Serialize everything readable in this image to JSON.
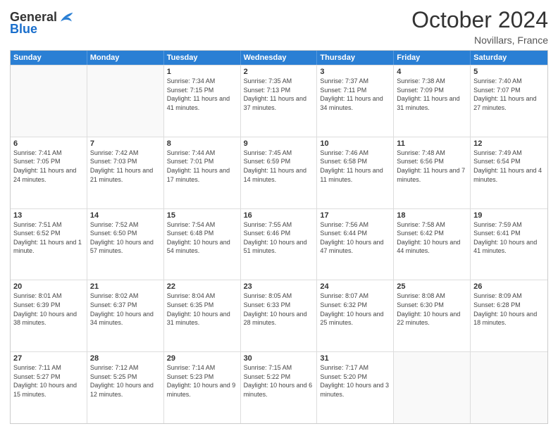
{
  "header": {
    "logo_general": "General",
    "logo_blue": "Blue",
    "month_title": "October 2024",
    "location": "Novillars, France"
  },
  "weekdays": [
    "Sunday",
    "Monday",
    "Tuesday",
    "Wednesday",
    "Thursday",
    "Friday",
    "Saturday"
  ],
  "weeks": [
    [
      {
        "day": "",
        "info": ""
      },
      {
        "day": "",
        "info": ""
      },
      {
        "day": "1",
        "info": "Sunrise: 7:34 AM\nSunset: 7:15 PM\nDaylight: 11 hours and 41 minutes."
      },
      {
        "day": "2",
        "info": "Sunrise: 7:35 AM\nSunset: 7:13 PM\nDaylight: 11 hours and 37 minutes."
      },
      {
        "day": "3",
        "info": "Sunrise: 7:37 AM\nSunset: 7:11 PM\nDaylight: 11 hours and 34 minutes."
      },
      {
        "day": "4",
        "info": "Sunrise: 7:38 AM\nSunset: 7:09 PM\nDaylight: 11 hours and 31 minutes."
      },
      {
        "day": "5",
        "info": "Sunrise: 7:40 AM\nSunset: 7:07 PM\nDaylight: 11 hours and 27 minutes."
      }
    ],
    [
      {
        "day": "6",
        "info": "Sunrise: 7:41 AM\nSunset: 7:05 PM\nDaylight: 11 hours and 24 minutes."
      },
      {
        "day": "7",
        "info": "Sunrise: 7:42 AM\nSunset: 7:03 PM\nDaylight: 11 hours and 21 minutes."
      },
      {
        "day": "8",
        "info": "Sunrise: 7:44 AM\nSunset: 7:01 PM\nDaylight: 11 hours and 17 minutes."
      },
      {
        "day": "9",
        "info": "Sunrise: 7:45 AM\nSunset: 6:59 PM\nDaylight: 11 hours and 14 minutes."
      },
      {
        "day": "10",
        "info": "Sunrise: 7:46 AM\nSunset: 6:58 PM\nDaylight: 11 hours and 11 minutes."
      },
      {
        "day": "11",
        "info": "Sunrise: 7:48 AM\nSunset: 6:56 PM\nDaylight: 11 hours and 7 minutes."
      },
      {
        "day": "12",
        "info": "Sunrise: 7:49 AM\nSunset: 6:54 PM\nDaylight: 11 hours and 4 minutes."
      }
    ],
    [
      {
        "day": "13",
        "info": "Sunrise: 7:51 AM\nSunset: 6:52 PM\nDaylight: 11 hours and 1 minute."
      },
      {
        "day": "14",
        "info": "Sunrise: 7:52 AM\nSunset: 6:50 PM\nDaylight: 10 hours and 57 minutes."
      },
      {
        "day": "15",
        "info": "Sunrise: 7:54 AM\nSunset: 6:48 PM\nDaylight: 10 hours and 54 minutes."
      },
      {
        "day": "16",
        "info": "Sunrise: 7:55 AM\nSunset: 6:46 PM\nDaylight: 10 hours and 51 minutes."
      },
      {
        "day": "17",
        "info": "Sunrise: 7:56 AM\nSunset: 6:44 PM\nDaylight: 10 hours and 47 minutes."
      },
      {
        "day": "18",
        "info": "Sunrise: 7:58 AM\nSunset: 6:42 PM\nDaylight: 10 hours and 44 minutes."
      },
      {
        "day": "19",
        "info": "Sunrise: 7:59 AM\nSunset: 6:41 PM\nDaylight: 10 hours and 41 minutes."
      }
    ],
    [
      {
        "day": "20",
        "info": "Sunrise: 8:01 AM\nSunset: 6:39 PM\nDaylight: 10 hours and 38 minutes."
      },
      {
        "day": "21",
        "info": "Sunrise: 8:02 AM\nSunset: 6:37 PM\nDaylight: 10 hours and 34 minutes."
      },
      {
        "day": "22",
        "info": "Sunrise: 8:04 AM\nSunset: 6:35 PM\nDaylight: 10 hours and 31 minutes."
      },
      {
        "day": "23",
        "info": "Sunrise: 8:05 AM\nSunset: 6:33 PM\nDaylight: 10 hours and 28 minutes."
      },
      {
        "day": "24",
        "info": "Sunrise: 8:07 AM\nSunset: 6:32 PM\nDaylight: 10 hours and 25 minutes."
      },
      {
        "day": "25",
        "info": "Sunrise: 8:08 AM\nSunset: 6:30 PM\nDaylight: 10 hours and 22 minutes."
      },
      {
        "day": "26",
        "info": "Sunrise: 8:09 AM\nSunset: 6:28 PM\nDaylight: 10 hours and 18 minutes."
      }
    ],
    [
      {
        "day": "27",
        "info": "Sunrise: 7:11 AM\nSunset: 5:27 PM\nDaylight: 10 hours and 15 minutes."
      },
      {
        "day": "28",
        "info": "Sunrise: 7:12 AM\nSunset: 5:25 PM\nDaylight: 10 hours and 12 minutes."
      },
      {
        "day": "29",
        "info": "Sunrise: 7:14 AM\nSunset: 5:23 PM\nDaylight: 10 hours and 9 minutes."
      },
      {
        "day": "30",
        "info": "Sunrise: 7:15 AM\nSunset: 5:22 PM\nDaylight: 10 hours and 6 minutes."
      },
      {
        "day": "31",
        "info": "Sunrise: 7:17 AM\nSunset: 5:20 PM\nDaylight: 10 hours and 3 minutes."
      },
      {
        "day": "",
        "info": ""
      },
      {
        "day": "",
        "info": ""
      }
    ]
  ]
}
